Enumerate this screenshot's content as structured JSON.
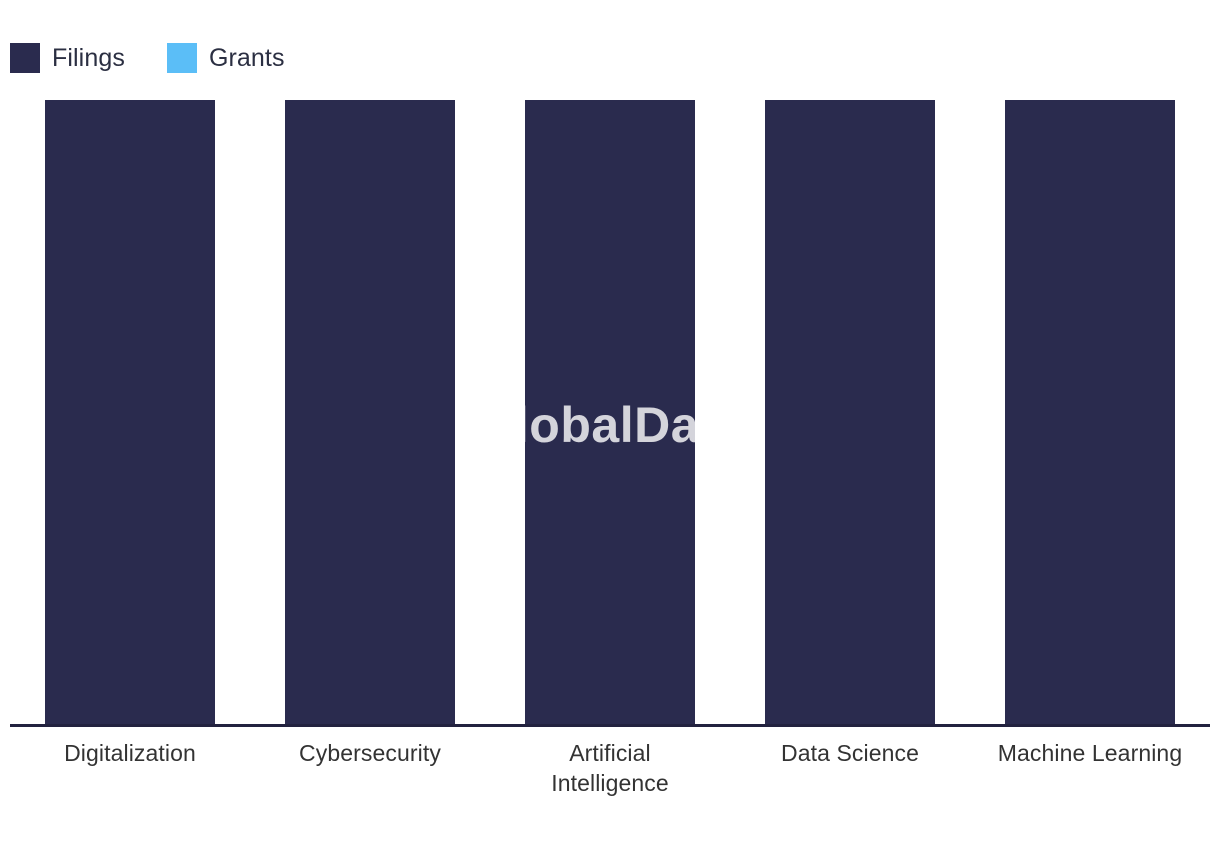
{
  "legend": {
    "position": "top-left",
    "items": [
      {
        "label": "Filings",
        "color": "#2a2b4e",
        "swatch_name": "legend-swatch-filings"
      },
      {
        "label": "Grants",
        "color": "#5bbef7",
        "swatch_name": "legend-swatch-grants"
      }
    ]
  },
  "watermark": {
    "text": "GlobalData"
  },
  "axis": {
    "line_color": "#22223f",
    "label_color": "#333333"
  },
  "categories": [
    {
      "line1": "Digitalization",
      "line2": ""
    },
    {
      "line1": "Cybersecurity",
      "line2": ""
    },
    {
      "line1": "Artificial",
      "line2": "Intelligence"
    },
    {
      "line1": "Data Science",
      "line2": ""
    },
    {
      "line1": "Machine Learning",
      "line2": ""
    }
  ],
  "chart_data": {
    "type": "bar",
    "title": "",
    "subtitle": "",
    "xlabel": "",
    "ylabel": "",
    "categories": [
      "Digitalization",
      "Cybersecurity",
      "Artificial Intelligence",
      "Data Science",
      "Machine Learning"
    ],
    "series": [
      {
        "name": "Filings",
        "color": "#2a2b4e",
        "values": [
          100,
          100,
          100,
          100,
          100
        ]
      },
      {
        "name": "Grants",
        "color": "#5bbef7",
        "values": [
          0,
          0,
          0,
          0,
          0
        ]
      }
    ],
    "ylim": [
      0,
      100
    ],
    "grid": false,
    "legend_position": "top-left",
    "axis_labels_visible": false,
    "notes": "All Filings bars are rendered at identical full height; Grants series has no visible height."
  }
}
